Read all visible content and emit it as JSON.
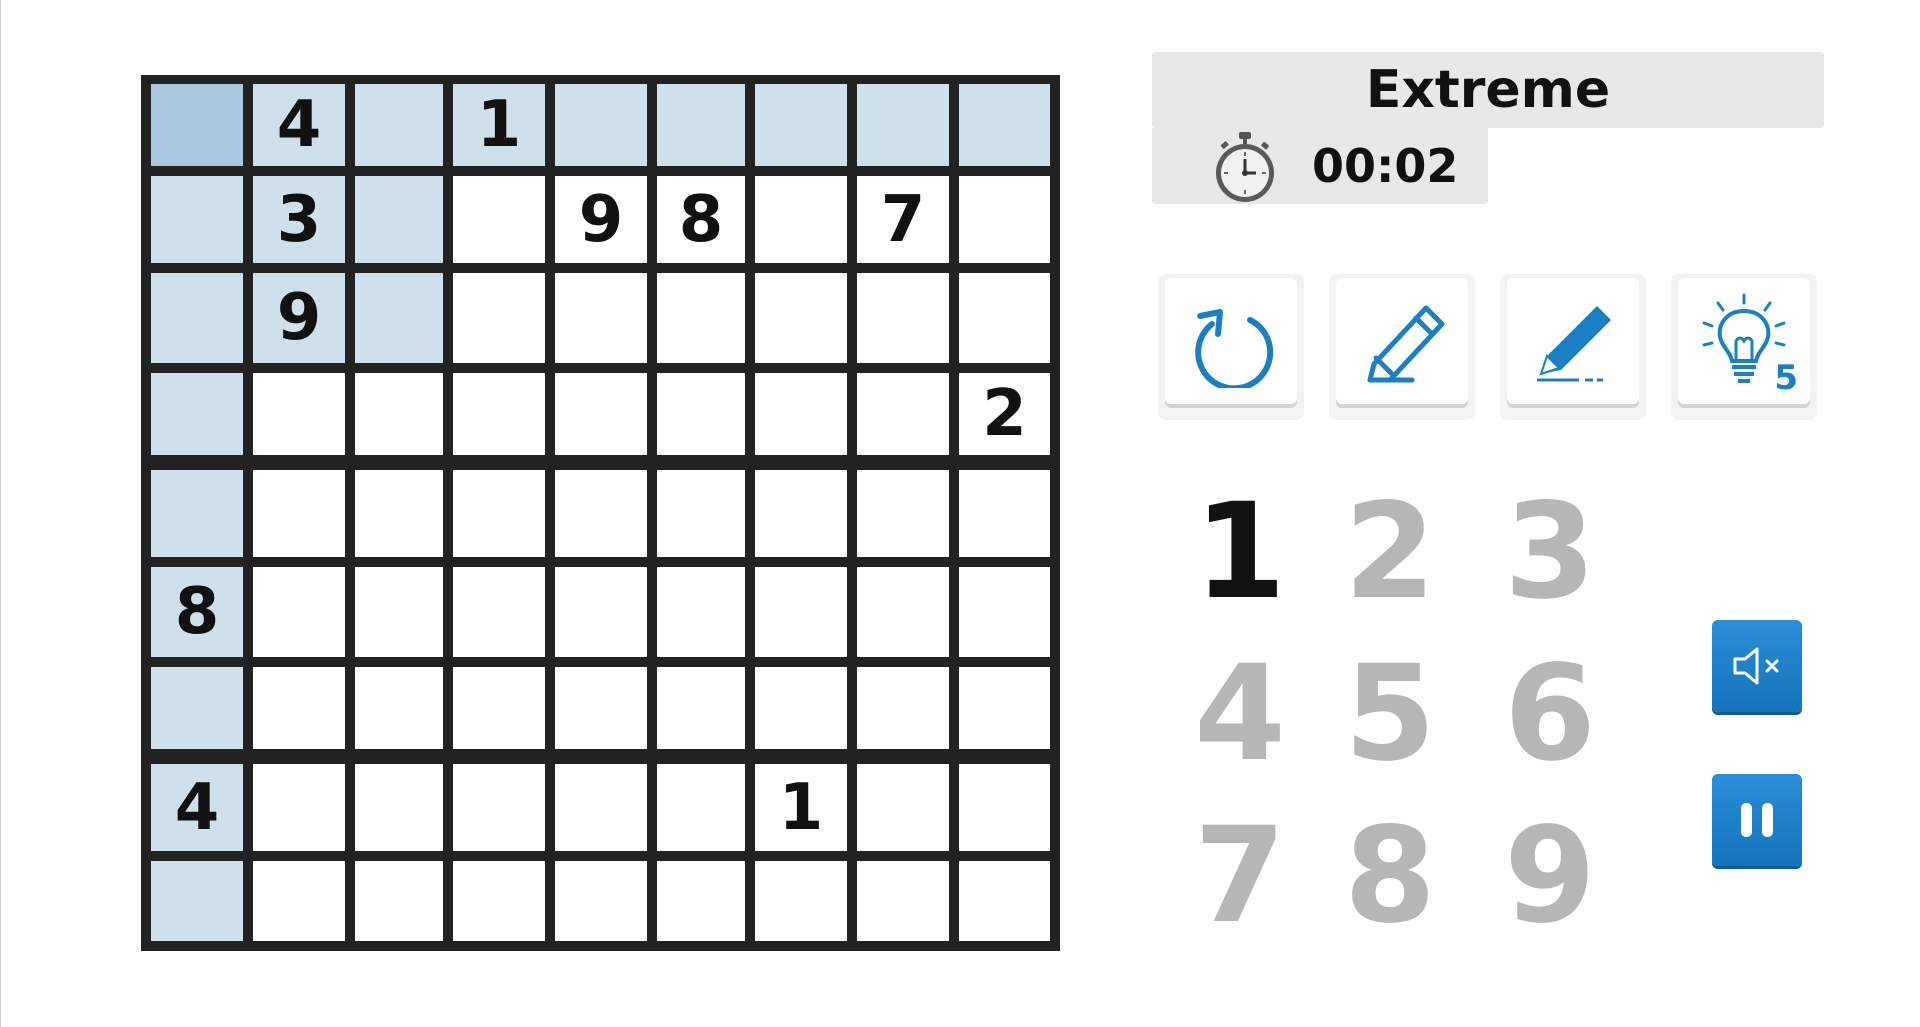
{
  "header": {
    "difficulty": "Extreme",
    "timer": "00:02"
  },
  "board": {
    "grid": [
      [
        "",
        "4",
        "",
        "1",
        "",
        "",
        "",
        "",
        ""
      ],
      [
        "",
        "3",
        "",
        "",
        "9",
        "8",
        "",
        "7",
        ""
      ],
      [
        "",
        "9",
        "",
        "",
        "",
        "",
        "",
        "",
        ""
      ],
      [
        "",
        "",
        "",
        "",
        "",
        "",
        "",
        "",
        "2"
      ],
      [
        "",
        "",
        "",
        "",
        "",
        "",
        "",
        "",
        ""
      ],
      [
        "8",
        "",
        "",
        "",
        "",
        "",
        "",
        "",
        ""
      ],
      [
        "",
        "",
        "",
        "",
        "",
        "",
        "",
        "",
        ""
      ],
      [
        "4",
        "",
        "",
        "",
        "",
        "",
        "1",
        "",
        ""
      ],
      [
        "",
        "",
        "",
        "",
        "",
        "",
        "",
        "",
        ""
      ]
    ],
    "selected": {
      "row": 0,
      "col": 0
    },
    "colors": {
      "highlight": "#cde0ec",
      "selected": "#a9c8df"
    }
  },
  "tools": [
    {
      "name": "undo-button",
      "icon": "undo-icon"
    },
    {
      "name": "erase-button",
      "icon": "eraser-icon"
    },
    {
      "name": "pencil-button",
      "icon": "pencil-icon"
    },
    {
      "name": "hint-button",
      "icon": "lightbulb-icon",
      "count": "5"
    }
  ],
  "numpad": {
    "digits": [
      "1",
      "2",
      "3",
      "4",
      "5",
      "6",
      "7",
      "8",
      "9"
    ],
    "active": "1"
  },
  "side_buttons": {
    "sound": {
      "icon": "speaker-muted-icon"
    },
    "pause": {
      "icon": "pause-icon"
    }
  },
  "accent_color": "#1b7fc4"
}
